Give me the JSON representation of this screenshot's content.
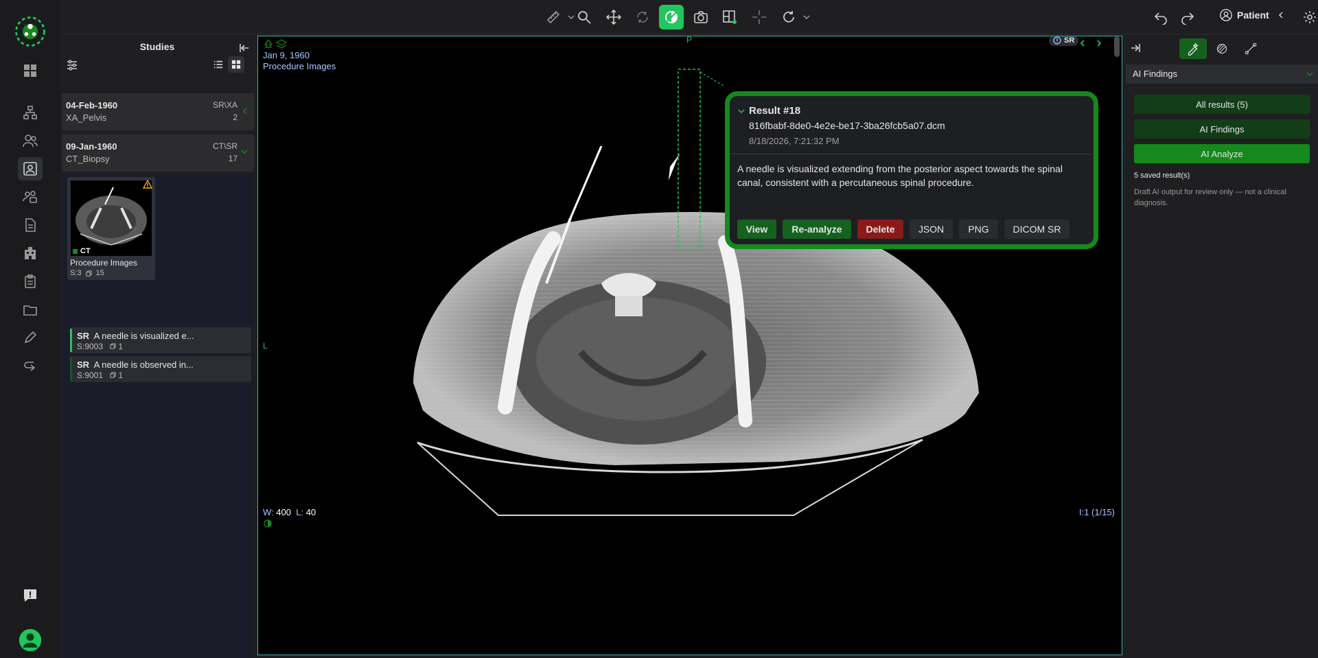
{
  "topbar": {
    "patient_label": "Patient"
  },
  "studies_panel": {
    "title": "Studies",
    "studies": [
      {
        "date": "04-Feb-1960",
        "description": "XA_Pelvis",
        "modality": "SR\\XA",
        "count": "2"
      },
      {
        "date": "09-Jan-1960",
        "description": "CT_Biopsy",
        "modality": "CT\\SR",
        "count": "17"
      }
    ],
    "thumbnail": {
      "modality": "CT",
      "title": "Procedure Images",
      "series": "S:3",
      "instances": "15"
    },
    "sr_items": [
      {
        "tag": "SR",
        "text": "A needle is visualized e...",
        "series": "S:9003",
        "instances": "1",
        "bar_color": "#22c55e"
      },
      {
        "tag": "SR",
        "text": "A needle is observed in...",
        "series": "S:9001",
        "instances": "1",
        "bar_color": "#14532d"
      }
    ]
  },
  "viewport": {
    "study_date": "Jan 9, 1960",
    "series_desc": "Procedure Images",
    "orient_top": "P",
    "orient_left": "L",
    "sr_badge": "SR",
    "wl_w_label": "W:",
    "wl_w": "400",
    "wl_l_label": "L:",
    "wl_l": "40",
    "image_index": "I:1 (1/15)"
  },
  "result_popup": {
    "title": "Result #18",
    "filename": "816fbabf-8de0-4e2e-be17-3ba26fcb5a07.dcm",
    "timestamp": "8/18/2026, 7:21:32 PM",
    "description": "A needle is visualized extending from the posterior aspect towards the spinal canal, consistent with a percutaneous spinal procedure.",
    "buttons": {
      "view": "View",
      "reanalyze": "Re-analyze",
      "delete": "Delete",
      "json": "JSON",
      "png": "PNG",
      "dicom_sr": "DICOM SR"
    }
  },
  "right_panel": {
    "section_title": "AI Findings",
    "all_results": "All results (5)",
    "ai_findings": "AI Findings",
    "ai_analyze": "AI Analyze",
    "saved_count": "5 saved result(s)",
    "disclaimer": "Draft AI output for review only — not a clinical diagnosis."
  },
  "colors": {
    "accent": "#22c55e",
    "popup_border": "#15891c",
    "delete": "#8b1a1a",
    "viewport_border": "#2fb7b0",
    "overlay_text": "#a8c7ff"
  }
}
